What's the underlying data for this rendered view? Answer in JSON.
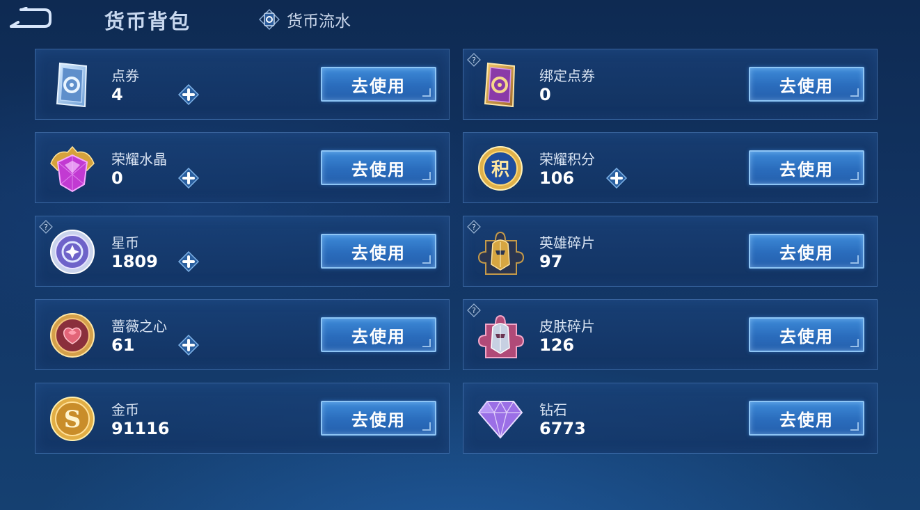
{
  "header": {
    "title": "货币背包",
    "flow_tab_label": "货币流水"
  },
  "cards": [
    {
      "name": "点券",
      "value": "4",
      "button": "去使用",
      "icon": "coupon-ticket-icon",
      "has_plus": true,
      "has_help": false
    },
    {
      "name": "绑定点券",
      "value": "0",
      "button": "去使用",
      "icon": "bound-coupon-ticket-icon",
      "has_plus": false,
      "has_help": true
    },
    {
      "name": "荣耀水晶",
      "value": "0",
      "button": "去使用",
      "icon": "glory-crystal-icon",
      "has_plus": true,
      "has_help": false
    },
    {
      "name": "荣耀积分",
      "value": "106",
      "button": "去使用",
      "icon": "glory-points-icon",
      "has_plus": true,
      "has_help": false
    },
    {
      "name": "星币",
      "value": "1809",
      "button": "去使用",
      "icon": "star-coin-icon",
      "has_plus": true,
      "has_help": true
    },
    {
      "name": "英雄碎片",
      "value": "97",
      "button": "去使用",
      "icon": "hero-fragment-icon",
      "has_plus": false,
      "has_help": true
    },
    {
      "name": "蔷薇之心",
      "value": "61",
      "button": "去使用",
      "icon": "rose-heart-icon",
      "has_plus": true,
      "has_help": false
    },
    {
      "name": "皮肤碎片",
      "value": "126",
      "button": "去使用",
      "icon": "skin-fragment-icon",
      "has_plus": false,
      "has_help": true
    },
    {
      "name": "金币",
      "value": "91116",
      "button": "去使用",
      "icon": "gold-coin-icon",
      "has_plus": false,
      "has_help": false
    },
    {
      "name": "钻石",
      "value": "6773",
      "button": "去使用",
      "icon": "diamond-icon",
      "has_plus": false,
      "has_help": false
    }
  ],
  "colors": {
    "background": "#123463",
    "button": "#2f79c9",
    "button_border": "#8ec5f5",
    "card_border": "#5a8ccd"
  }
}
